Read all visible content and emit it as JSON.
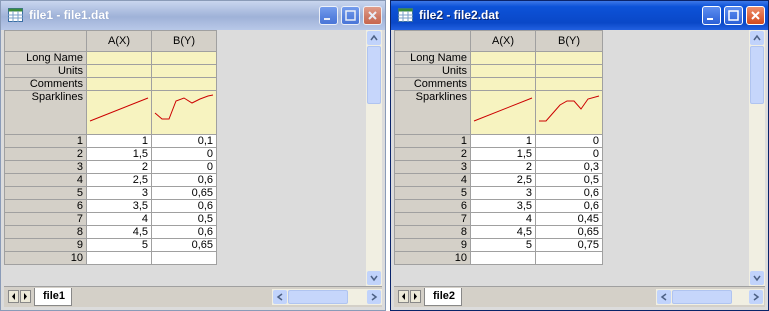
{
  "windows": [
    {
      "title": "file1 - file1.dat",
      "sheet_tab": "file1",
      "columns": [
        "A(X)",
        "B(Y)"
      ],
      "meta_rows": [
        "Long Name",
        "Units",
        "Comments",
        "Sparklines"
      ],
      "rows": [
        {
          "n": "1",
          "a": "1",
          "b": "0,1"
        },
        {
          "n": "2",
          "a": "1,5",
          "b": "0"
        },
        {
          "n": "3",
          "a": "2",
          "b": "0"
        },
        {
          "n": "4",
          "a": "2,5",
          "b": "0,6"
        },
        {
          "n": "5",
          "a": "3",
          "b": "0,65"
        },
        {
          "n": "6",
          "a": "3,5",
          "b": "0,6"
        },
        {
          "n": "7",
          "a": "4",
          "b": "0,5"
        },
        {
          "n": "8",
          "a": "4,5",
          "b": "0,6"
        },
        {
          "n": "9",
          "a": "5",
          "b": "0,65"
        },
        {
          "n": "10",
          "a": "",
          "b": ""
        }
      ]
    },
    {
      "title": "file2 - file2.dat",
      "sheet_tab": "file2",
      "columns": [
        "A(X)",
        "B(Y)"
      ],
      "meta_rows": [
        "Long Name",
        "Units",
        "Comments",
        "Sparklines"
      ],
      "rows": [
        {
          "n": "1",
          "a": "1",
          "b": "0"
        },
        {
          "n": "2",
          "a": "1,5",
          "b": "0"
        },
        {
          "n": "3",
          "a": "2",
          "b": "0,3"
        },
        {
          "n": "4",
          "a": "2,5",
          "b": "0,5"
        },
        {
          "n": "5",
          "a": "3",
          "b": "0,6"
        },
        {
          "n": "6",
          "a": "3,5",
          "b": "0,6"
        },
        {
          "n": "7",
          "a": "4",
          "b": "0,45"
        },
        {
          "n": "8",
          "a": "4,5",
          "b": "0,65"
        },
        {
          "n": "9",
          "a": "5",
          "b": "0,75"
        },
        {
          "n": "10",
          "a": "",
          "b": ""
        }
      ]
    }
  ],
  "colors": {
    "sparkline": "#cc0000",
    "meta_fill": "#f7f3c0",
    "active_title": "#0a48c8",
    "inactive_title": "#a6b8dc"
  },
  "icons": [
    "worksheet-icon",
    "minimize-icon",
    "maximize-icon",
    "close-icon",
    "scroll-up-icon",
    "scroll-down-icon",
    "scroll-left-icon",
    "scroll-right-icon"
  ]
}
